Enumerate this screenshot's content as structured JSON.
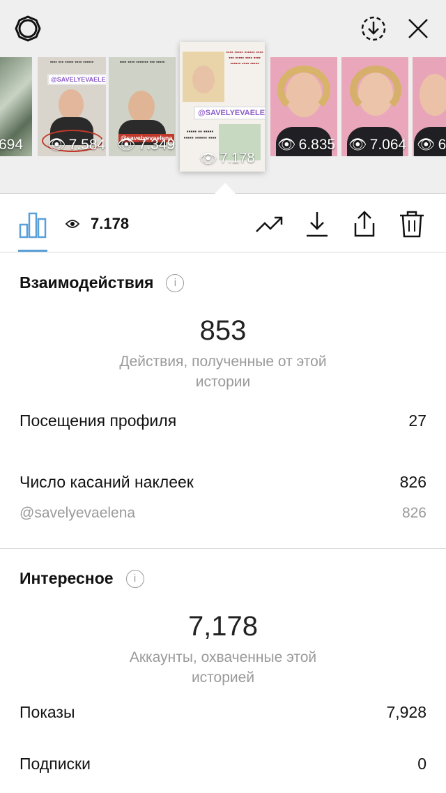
{
  "header": {
    "icons": [
      "settings-icon",
      "download-circle-icon",
      "close-icon"
    ]
  },
  "stories": [
    {
      "views": "694"
    },
    {
      "views": "7.584",
      "handle": "@SAVELYEVAELENA"
    },
    {
      "views": "7.349",
      "handle": "@savelyevaelena"
    },
    {
      "views": "7.178",
      "handle": "@SAVELYEVAELENA",
      "active": true
    },
    {
      "views": "6.835"
    },
    {
      "views": "7.064"
    },
    {
      "views": "6."
    }
  ],
  "toolbar": {
    "views": "7.178",
    "icons": [
      "bar-chart-icon",
      "eye-icon",
      "trending-icon",
      "download-icon",
      "share-icon",
      "trash-icon"
    ]
  },
  "interactions": {
    "title": "Взаимодействия",
    "total": "853",
    "caption": "Действия, полученные от этой истории",
    "rows": [
      {
        "label": "Посещения профиля",
        "value": "27"
      },
      {
        "label": "Число касаний наклеек",
        "value": "826"
      },
      {
        "label": "@savelyevaelena",
        "value": "826"
      }
    ]
  },
  "discovery": {
    "title": "Интересное",
    "total": "7,178",
    "caption": "Аккаунты, охваченные этой историей",
    "rows": [
      {
        "label": "Показы",
        "value": "7,928"
      },
      {
        "label": "Подписки",
        "value": "0"
      }
    ]
  },
  "colors": {
    "accent": "#5aa0d8",
    "muted": "#9a9a9a",
    "top_bg": "#efefef"
  }
}
